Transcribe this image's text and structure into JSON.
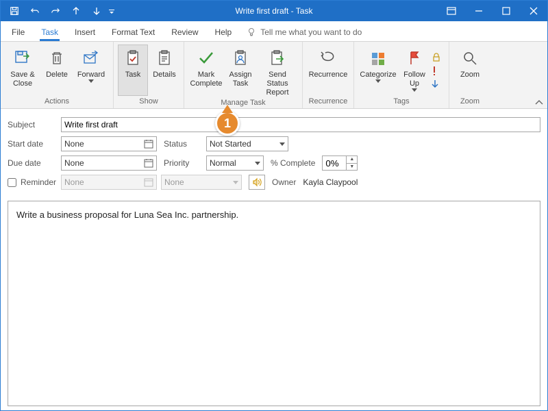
{
  "title": "Write first draft  -  Task",
  "tabs": {
    "file": "File",
    "task": "Task",
    "insert": "Insert",
    "format": "Format Text",
    "review": "Review",
    "help": "Help",
    "tellme": "Tell me what you want to do"
  },
  "ribbon": {
    "actions": {
      "saveclose": "Save &\nClose",
      "delete": "Delete",
      "forward": "Forward",
      "group": "Actions"
    },
    "show": {
      "task": "Task",
      "details": "Details",
      "group": "Show"
    },
    "manage": {
      "markcomplete": "Mark\nComplete",
      "assign": "Assign\nTask",
      "sendstatus": "Send Status\nReport",
      "group": "Manage Task"
    },
    "recurrence": {
      "btn": "Recurrence",
      "group": "Recurrence"
    },
    "tags": {
      "categorize": "Categorize",
      "followup": "Follow\nUp",
      "group": "Tags"
    },
    "zoom": {
      "btn": "Zoom",
      "group": "Zoom"
    }
  },
  "form": {
    "subject_lbl": "Subject",
    "subject_val": "Write first draft",
    "startdate_lbl": "Start date",
    "startdate_val": "None",
    "duedate_lbl": "Due date",
    "duedate_val": "None",
    "reminder_lbl": "Reminder",
    "reminder_date": "None",
    "reminder_time": "None",
    "status_lbl": "Status",
    "status_val": "Not Started",
    "priority_lbl": "Priority",
    "priority_val": "Normal",
    "pct_lbl": "% Complete",
    "pct_val": "0%",
    "owner_lbl": "Owner",
    "owner_val": "Kayla Claypool"
  },
  "body": "Write a business proposal for Luna Sea Inc. partnership.",
  "callout": "1"
}
